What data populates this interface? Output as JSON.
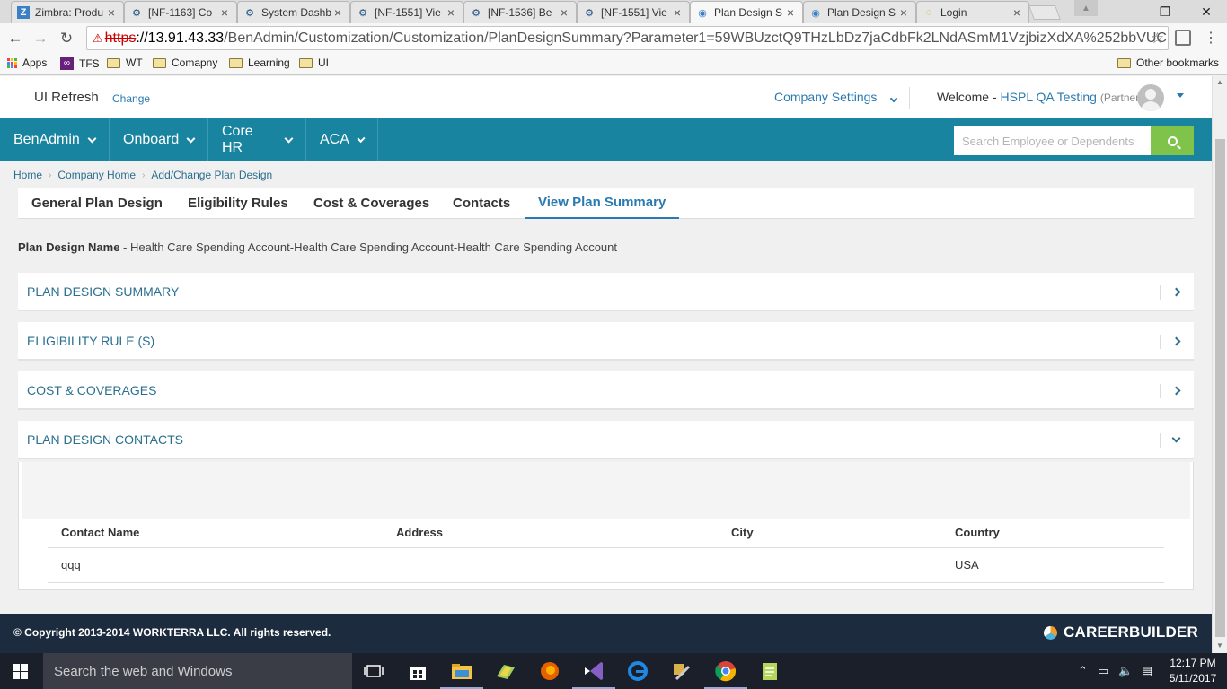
{
  "browser": {
    "tabs": [
      {
        "title": "Zimbra: Produ",
        "icon": "zimbra-icon"
      },
      {
        "title": "[NF-1163] Co",
        "icon": "jira-icon"
      },
      {
        "title": "System Dashb",
        "icon": "jira-icon"
      },
      {
        "title": "[NF-1551] Vie",
        "icon": "jira-icon"
      },
      {
        "title": "[NF-1536] Be",
        "icon": "jira-icon"
      },
      {
        "title": "[NF-1551] Vie",
        "icon": "jira-icon"
      },
      {
        "title": "Plan Design S",
        "icon": "page-icon"
      },
      {
        "title": "Plan Design S",
        "icon": "page-icon"
      },
      {
        "title": "Login",
        "icon": "loading-icon"
      }
    ],
    "url": {
      "protocol": "https",
      "host": "://13.91.43.33",
      "path": "/BenAdmin/Customization/Customization/PlanDesignSummary?Parameter1=59WBUzctQ9THzLbDz7jaCdbFk2LNdASmM1VzjbizXdXA%252bbVUC"
    },
    "bookmarks": {
      "apps": "Apps",
      "items": [
        "TFS",
        "WT",
        "Comapny",
        "Learning",
        "UI"
      ],
      "other": "Other bookmarks"
    }
  },
  "app": {
    "brand": "UI Refresh",
    "change_link": "Change",
    "company_settings": "Company Settings",
    "welcome_label": "Welcome -",
    "user_name": "HSPL QA Testing",
    "user_role": "(Partner)",
    "nav": [
      "BenAdmin",
      "Onboard",
      "Core HR",
      "ACA"
    ],
    "search_placeholder": "Search Employee or Dependents",
    "breadcrumb": [
      "Home",
      "Company Home",
      "Add/Change Plan Design"
    ],
    "page_tabs": [
      "General Plan Design",
      "Eligibility Rules",
      "Cost & Coverages",
      "Contacts",
      "View Plan Summary"
    ],
    "plan_name_label": "Plan Design Name",
    "plan_name_value": " - Health Care Spending Account-Health Care Spending Account-Health Care Spending Account",
    "sections": [
      {
        "title": "PLAN DESIGN SUMMARY",
        "expanded": false
      },
      {
        "title": "ELIGIBILITY RULE (S)",
        "expanded": false
      },
      {
        "title": "COST & COVERAGES",
        "expanded": false
      },
      {
        "title": "PLAN DESIGN CONTACTS",
        "expanded": true
      }
    ],
    "contacts_table": {
      "headers": [
        "Contact Name",
        "Address",
        "City",
        "Country"
      ],
      "rows": [
        [
          "qqq",
          "",
          "",
          "USA"
        ]
      ]
    },
    "footer_copyright": "© Copyright 2013-2014 WORKTERRA LLC. All rights reserved.",
    "footer_logo": "CAREERBUILDER"
  },
  "taskbar": {
    "search_placeholder": "Search the web and Windows",
    "time": "12:17 PM",
    "date": "5/11/2017"
  },
  "colors": {
    "nav_bar": "#1884a0",
    "accent_link": "#2a7ab0",
    "search_button": "#80c34b",
    "footer": "#1c2b3d"
  }
}
